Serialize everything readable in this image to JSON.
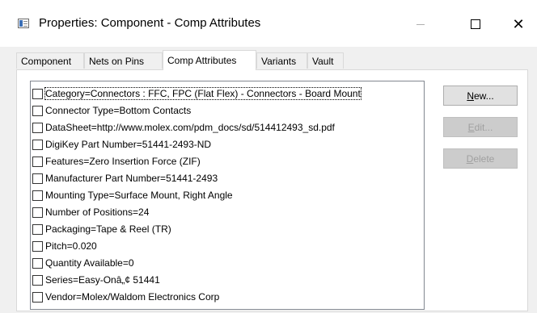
{
  "window": {
    "title": "Properties: Component - Comp Attributes",
    "close_glyph": "✕"
  },
  "tabs": [
    {
      "label": "Component",
      "active": false
    },
    {
      "label": "Nets on Pins",
      "active": false
    },
    {
      "label": "Comp Attributes",
      "active": true
    },
    {
      "label": "Variants",
      "active": false
    },
    {
      "label": "Vault",
      "active": false
    }
  ],
  "attributes": [
    {
      "text": "Category=Connectors  : FFC, FPC (Flat Flex) - Connectors - Board Mount",
      "checked": false
    },
    {
      "text": "Connector Type=Bottom Contacts",
      "checked": false
    },
    {
      "text": "DataSheet=http://www.molex.com/pdm_docs/sd/514412493_sd.pdf",
      "checked": false
    },
    {
      "text": "DigiKey Part Number=51441-2493-ND",
      "checked": false
    },
    {
      "text": "Features=Zero Insertion Force (ZIF)",
      "checked": false
    },
    {
      "text": "Manufacturer Part Number=51441-2493",
      "checked": false
    },
    {
      "text": "Mounting Type=Surface Mount, Right Angle",
      "checked": false
    },
    {
      "text": "Number of Positions=24",
      "checked": false
    },
    {
      "text": "Packaging=Tape & Reel (TR)",
      "checked": false
    },
    {
      "text": "Pitch=0.020",
      "checked": false
    },
    {
      "text": "Quantity Available=0",
      "checked": false
    },
    {
      "text": "Series=Easy-Onâ„¢ 51441",
      "checked": false
    },
    {
      "text": "Vendor=Molex/Waldom Electronics Corp",
      "checked": false
    }
  ],
  "buttons": {
    "new": {
      "mnemonic": "N",
      "rest": "ew..."
    },
    "edit": {
      "mnemonic": "E",
      "rest": "dit..."
    },
    "delete": {
      "mnemonic": "D",
      "rest": "elete"
    }
  }
}
